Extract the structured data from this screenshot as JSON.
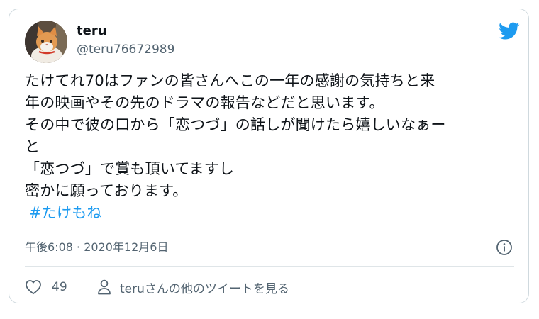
{
  "user": {
    "display_name": "teru",
    "handle": "@teru76672989"
  },
  "tweet": {
    "lines": [
      "たけてれ70はファンの皆さんへこの一年の感謝の気持ちと来",
      "年の映画やその先のドラマの報告などだと思います。",
      "その中で彼の口から「恋つづ」の話しが聞けたら嬉しいなぁー",
      "と",
      "「恋つづ」で賞も頂いてますし",
      "密かに願っております。"
    ],
    "hashtag": "#たけもね",
    "timestamp": "午後6:08 · 2020年12月6日"
  },
  "actions": {
    "like_count": "49",
    "more_tweets_label": "teruさんの他のツイートを見る"
  },
  "icons": {
    "brand": "twitter-bird-icon",
    "info": "info-icon",
    "like": "heart-icon",
    "profile": "person-icon"
  },
  "colors": {
    "accent": "#1d9bf0",
    "secondary_text": "#536471",
    "border": "#cfd9de"
  }
}
